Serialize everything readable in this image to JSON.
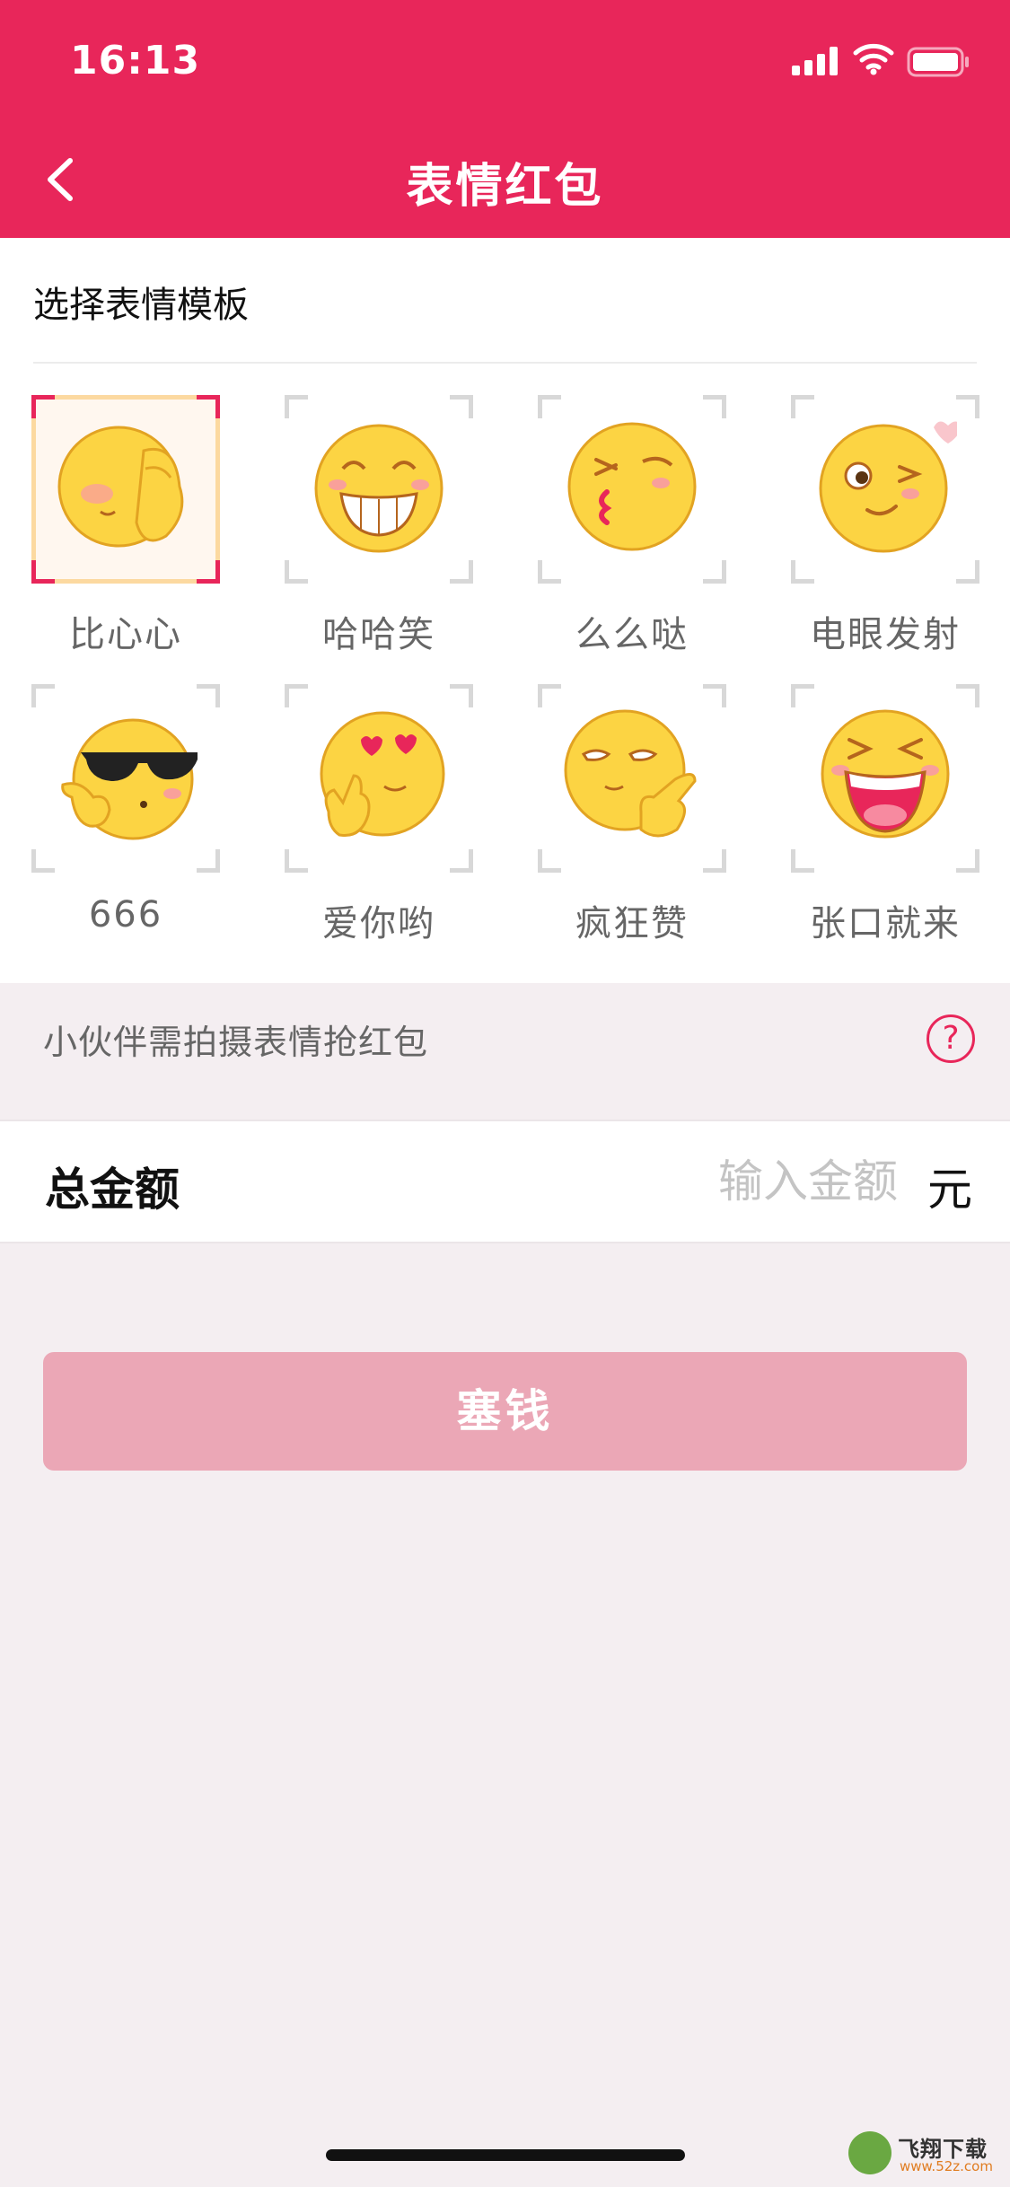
{
  "status_bar": {
    "time": "16:13"
  },
  "nav": {
    "title": "表情红包"
  },
  "templates": {
    "section_title": "选择表情模板",
    "items": [
      {
        "label": "比心心",
        "icon": "heart-hand-emoji",
        "selected": true
      },
      {
        "label": "哈哈笑",
        "icon": "laughing-emoji",
        "selected": false
      },
      {
        "label": "么么哒",
        "icon": "kissing-emoji",
        "selected": false
      },
      {
        "label": "电眼发射",
        "icon": "winking-emoji",
        "selected": false
      },
      {
        "label": "666",
        "icon": "sunglasses-666-emoji",
        "selected": false
      },
      {
        "label": "爱你哟",
        "icon": "heart-eyes-emoji",
        "selected": false
      },
      {
        "label": "疯狂赞",
        "icon": "thumbs-up-emoji",
        "selected": false
      },
      {
        "label": "张口就来",
        "icon": "open-mouth-laugh-emoji",
        "selected": false
      }
    ]
  },
  "hint": {
    "text": "小伙伴需拍摄表情抢红包",
    "help_glyph": "?"
  },
  "amount": {
    "label": "总金额",
    "placeholder": "输入金额",
    "value": "",
    "unit": "元"
  },
  "submit": {
    "label": "塞钱"
  },
  "watermark": {
    "text": "飞翔下载",
    "url": "www.52z.com"
  },
  "colors": {
    "brand": "#e8265a",
    "button_disabled": "#eba7b6",
    "page_bg": "#f4eef1",
    "emoji_yellow": "#fcd443",
    "emoji_outline": "#e2a322"
  }
}
